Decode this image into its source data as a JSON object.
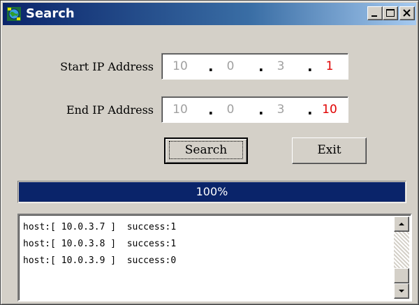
{
  "window": {
    "title": "Search",
    "icons": {
      "app": "network-globe-icon",
      "minimize": "minimize-icon",
      "maximize": "maximize-icon",
      "close": "close-icon"
    }
  },
  "form": {
    "start_label": "Start IP Address",
    "end_label": "End IP Address",
    "start_ip": {
      "o1": "10",
      "o2": "0",
      "o3": "3",
      "o4": "1"
    },
    "end_ip": {
      "o1": "10",
      "o2": "0",
      "o3": "3",
      "o4": "10"
    },
    "separator": "."
  },
  "buttons": {
    "search_label": "Search",
    "exit_label": "Exit"
  },
  "progress": {
    "value": 1.0,
    "text": "100%"
  },
  "log": {
    "lines": [
      "host:[ 10.0.3.7 ]  success:1",
      "host:[ 10.0.3.8 ]  success:1",
      "host:[ 10.0.3.9 ]  success:0"
    ]
  },
  "colors": {
    "title_bar": "#0a246a",
    "active_octet": "#e00000",
    "inactive_octet": "#a0a0a0",
    "progress_fill": "#0a246a"
  }
}
